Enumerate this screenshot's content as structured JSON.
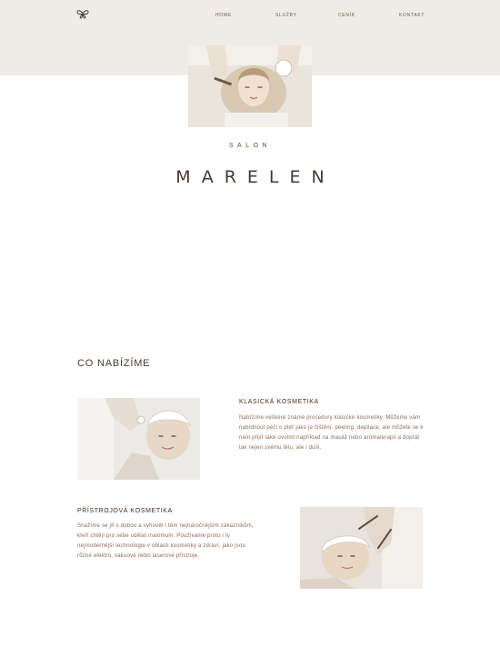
{
  "nav": {
    "logo_icon": "butterfly-logo-icon",
    "items": [
      "HOME",
      "SLUŽBY",
      "CENÍK",
      "KONTAKT"
    ]
  },
  "hero": {
    "salon_label": "SALON",
    "brand_name": "MARELEN"
  },
  "offer": {
    "heading": "CO NABÍZÍME",
    "services": [
      {
        "title": "KLASICKÁ KOSMETIKA",
        "text": "Nabízíme veškeré známé procedury klasické kosmetiky. Můžeme vám nabídnout péči o pleť jako je čištění, peeling, depilace, ale můžete se k nám přijít také uvolnit například na masáž nebo aromaterapii a dopřát tak nejen svému tělu, ale i duši."
      },
      {
        "title": "PŘÍSTROJOVÁ KOSMETIKA",
        "text": "Snažíme se jít s dobou a vyhovět i těm nejnáročnějším zákazníkům, kteří chtějí pro sebe udělat maximum. Používáme proto i ty nejmodernější technologie v oblasti kosmetiky a zdraví, jako jsou různé elektro, vakuové nebo laserové přístroje."
      }
    ]
  },
  "colors": {
    "band": "#efece5",
    "text_dark": "#4a382d",
    "text_body": "#8a6a55"
  }
}
